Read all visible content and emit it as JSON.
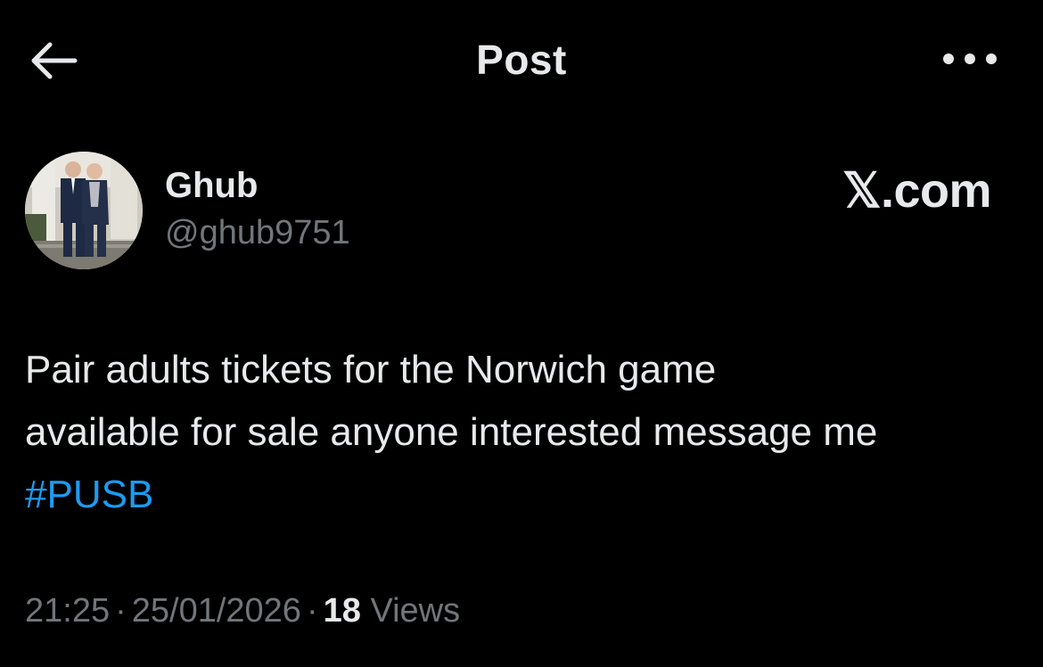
{
  "header": {
    "title": "Post",
    "back_icon": "arrow-left-icon",
    "more_icon": "more-horizontal-icon"
  },
  "post": {
    "author": {
      "name": "Ghub",
      "handle": "@ghub9751"
    },
    "watermark": "𝕏.com",
    "text_line1": "Pair adults tickets for the Norwich game",
    "text_line2": "available for sale anyone interested message me",
    "hashtag": "#PUSB",
    "time": "21:25",
    "date": "25/01/2026",
    "views_count": "18",
    "views_label": "Views",
    "separator": "·"
  },
  "colors": {
    "background": "#000000",
    "text_primary": "#e7e9ea",
    "text_secondary": "#71767b",
    "link": "#1d9bf0"
  }
}
